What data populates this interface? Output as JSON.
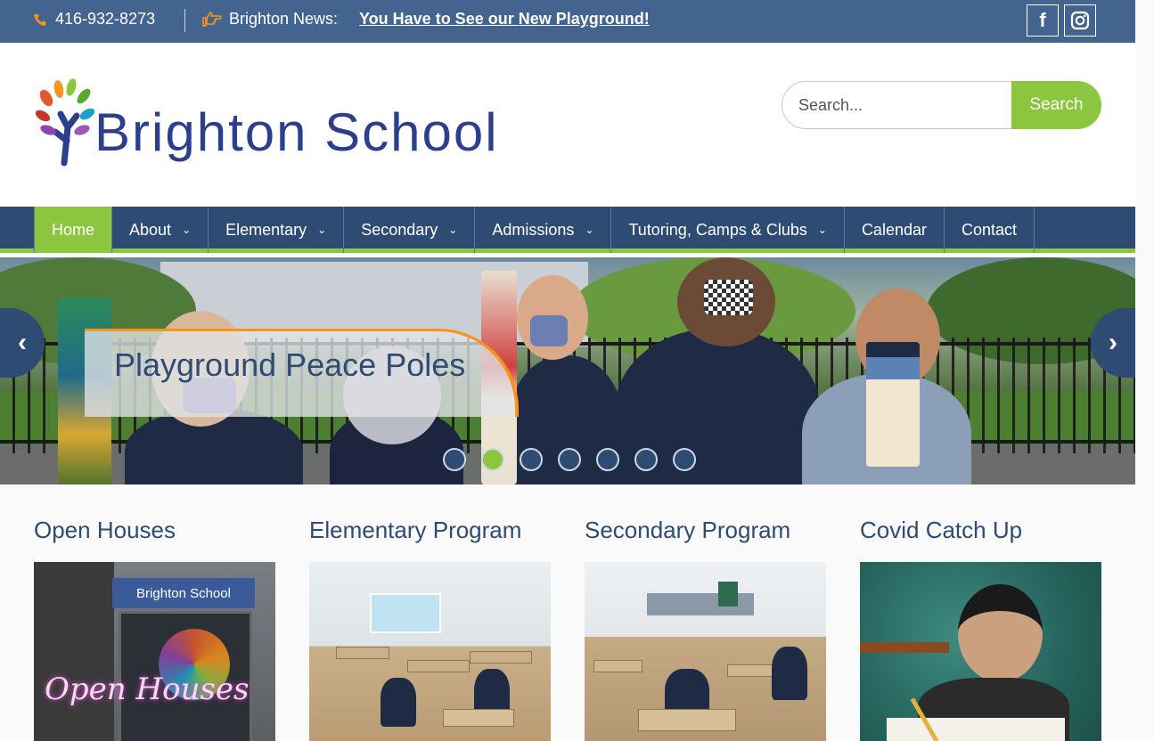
{
  "topbar": {
    "phone": "416-932-8273",
    "news_label": "Brighton News:",
    "news_link": "You Have to See our New Playground!",
    "facebook_icon": "facebook-icon",
    "instagram_icon": "instagram-icon"
  },
  "header": {
    "logo_text": "Brighton School",
    "search_placeholder": "Search...",
    "search_button": "Search"
  },
  "nav": {
    "items": [
      {
        "label": "Home"
      },
      {
        "label": "About"
      },
      {
        "label": "Elementary"
      },
      {
        "label": "Secondary"
      },
      {
        "label": "Admissions"
      },
      {
        "label": "Tutoring, Camps & Clubs"
      },
      {
        "label": "Calendar"
      },
      {
        "label": "Contact"
      }
    ]
  },
  "hero": {
    "caption": "Playground Peace Poles",
    "slide_count": 7,
    "active_slide": 2
  },
  "cards": [
    {
      "title": "Open Houses",
      "image_sign": "Brighton School",
      "image_neon": "Open Houses"
    },
    {
      "title": "Elementary Program"
    },
    {
      "title": "Secondary Program"
    },
    {
      "title": "Covid Catch Up"
    }
  ],
  "colors": {
    "topbar": "#43648f",
    "nav": "#2d4b73",
    "accent_green": "#8cc63f",
    "caption_orange": "#f7941d",
    "logo_blue": "#2c3e8c"
  }
}
